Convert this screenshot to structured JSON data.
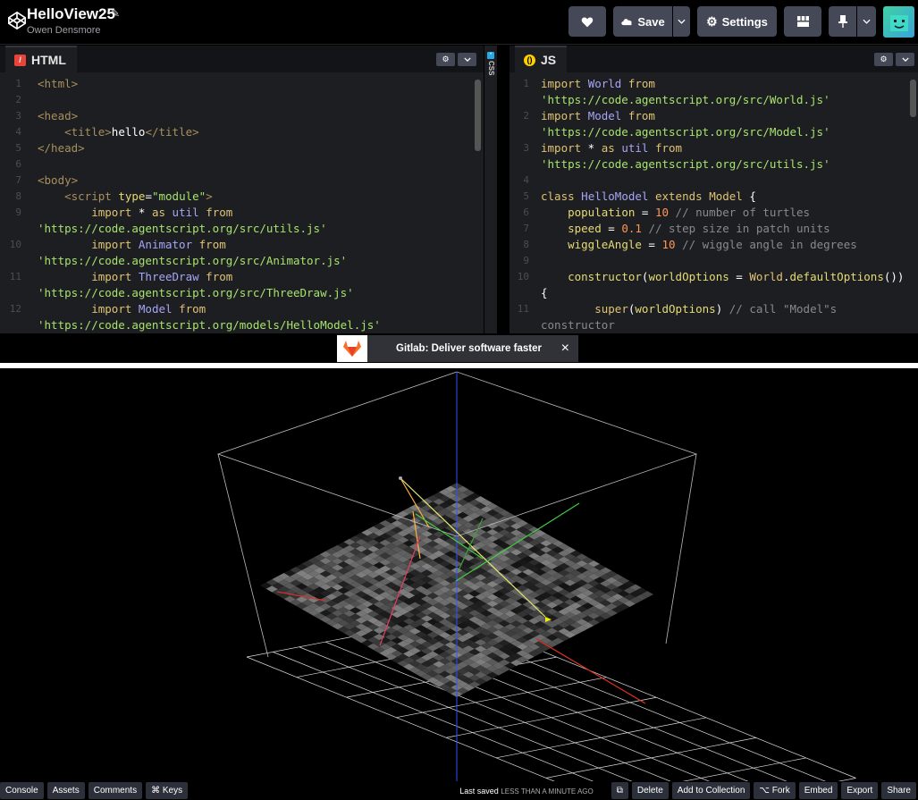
{
  "header": {
    "title": "HelloView25",
    "author": "Owen Densmore",
    "save_label": "Save",
    "settings_label": "Settings"
  },
  "html_editor": {
    "tab_label": "HTML",
    "lines": [
      {
        "n": "1",
        "t": [
          [
            "t-tag",
            "<html>"
          ]
        ]
      },
      {
        "n": "2",
        "t": []
      },
      {
        "n": "3",
        "t": [
          [
            "t-tag",
            "<head>"
          ]
        ]
      },
      {
        "n": "4",
        "t": [
          [
            "t-pl",
            "    "
          ],
          [
            "t-tag",
            "<title>"
          ],
          [
            "t-pl",
            "hello"
          ],
          [
            "t-tag",
            "</title>"
          ]
        ]
      },
      {
        "n": "5",
        "t": [
          [
            "t-tag",
            "</head>"
          ]
        ]
      },
      {
        "n": "6",
        "t": []
      },
      {
        "n": "7",
        "t": [
          [
            "t-tag",
            "<body>"
          ]
        ]
      },
      {
        "n": "8",
        "t": [
          [
            "t-pl",
            "    "
          ],
          [
            "t-tag",
            "<script "
          ],
          [
            "t-attr",
            "type"
          ],
          [
            "t-pl",
            "="
          ],
          [
            "t-str",
            "\"module\""
          ],
          [
            "t-tag",
            ">"
          ]
        ]
      },
      {
        "n": "9",
        "t": [
          [
            "t-pl",
            "        "
          ],
          [
            "t-kw",
            "import"
          ],
          [
            "t-pl",
            " * "
          ],
          [
            "t-kw",
            "as"
          ],
          [
            "t-pl",
            " "
          ],
          [
            "t-id",
            "util"
          ],
          [
            "t-pl",
            " "
          ],
          [
            "t-kw",
            "from"
          ]
        ]
      },
      {
        "n": "",
        "t": [
          [
            "t-str",
            "'https://code.agentscript.org/src/utils.js'"
          ]
        ]
      },
      {
        "n": "10",
        "t": [
          [
            "t-pl",
            "        "
          ],
          [
            "t-kw",
            "import"
          ],
          [
            "t-pl",
            " "
          ],
          [
            "t-id",
            "Animator"
          ],
          [
            "t-pl",
            " "
          ],
          [
            "t-kw",
            "from"
          ]
        ]
      },
      {
        "n": "",
        "t": [
          [
            "t-str",
            "'https://code.agentscript.org/src/Animator.js'"
          ]
        ]
      },
      {
        "n": "11",
        "t": [
          [
            "t-pl",
            "        "
          ],
          [
            "t-kw",
            "import"
          ],
          [
            "t-pl",
            " "
          ],
          [
            "t-id",
            "ThreeDraw"
          ],
          [
            "t-pl",
            " "
          ],
          [
            "t-kw",
            "from"
          ]
        ]
      },
      {
        "n": "",
        "t": [
          [
            "t-str",
            "'https://code.agentscript.org/src/ThreeDraw.js'"
          ]
        ]
      },
      {
        "n": "12",
        "t": [
          [
            "t-pl",
            "        "
          ],
          [
            "t-kw",
            "import"
          ],
          [
            "t-pl",
            " "
          ],
          [
            "t-id",
            "Model"
          ],
          [
            "t-pl",
            " "
          ],
          [
            "t-kw",
            "from"
          ]
        ]
      },
      {
        "n": "",
        "t": [
          [
            "t-str",
            "'https://code.agentscript.org/models/HelloModel.js'"
          ]
        ]
      }
    ]
  },
  "css_strip_label": "CSS",
  "js_editor": {
    "tab_label": "JS",
    "lines": [
      {
        "n": "1",
        "t": [
          [
            "t-kw",
            "import"
          ],
          [
            "t-pl",
            " "
          ],
          [
            "t-id",
            "World"
          ],
          [
            "t-pl",
            " "
          ],
          [
            "t-kw",
            "from"
          ]
        ]
      },
      {
        "n": "",
        "t": [
          [
            "t-str",
            "'https://code.agentscript.org/src/World.js'"
          ]
        ]
      },
      {
        "n": "2",
        "t": [
          [
            "t-kw",
            "import"
          ],
          [
            "t-pl",
            " "
          ],
          [
            "t-id",
            "Model"
          ],
          [
            "t-pl",
            " "
          ],
          [
            "t-kw",
            "from"
          ]
        ]
      },
      {
        "n": "",
        "t": [
          [
            "t-str",
            "'https://code.agentscript.org/src/Model.js'"
          ]
        ]
      },
      {
        "n": "3",
        "t": [
          [
            "t-kw",
            "import"
          ],
          [
            "t-pl",
            " * "
          ],
          [
            "t-kw",
            "as"
          ],
          [
            "t-pl",
            " "
          ],
          [
            "t-id",
            "util"
          ],
          [
            "t-pl",
            " "
          ],
          [
            "t-kw",
            "from"
          ]
        ]
      },
      {
        "n": "",
        "t": [
          [
            "t-str",
            "'https://code.agentscript.org/src/utils.js'"
          ]
        ]
      },
      {
        "n": "4",
        "t": []
      },
      {
        "n": "5",
        "t": [
          [
            "t-kw",
            "class"
          ],
          [
            "t-pl",
            " "
          ],
          [
            "t-id",
            "HelloModel"
          ],
          [
            "t-pl",
            " "
          ],
          [
            "t-kw",
            "extends"
          ],
          [
            "t-pl",
            " "
          ],
          [
            "t-kw",
            "Model"
          ],
          [
            "t-pl",
            " {"
          ]
        ]
      },
      {
        "n": "6",
        "t": [
          [
            "t-pl",
            "    "
          ],
          [
            "t-attr",
            "population"
          ],
          [
            "t-pl",
            " = "
          ],
          [
            "t-num",
            "10"
          ],
          [
            "t-pl",
            " "
          ],
          [
            "t-cmt",
            "// number of turtles"
          ]
        ]
      },
      {
        "n": "7",
        "t": [
          [
            "t-pl",
            "    "
          ],
          [
            "t-attr",
            "speed"
          ],
          [
            "t-pl",
            " = "
          ],
          [
            "t-num",
            "0.1"
          ],
          [
            "t-pl",
            " "
          ],
          [
            "t-cmt",
            "// step size in patch units"
          ]
        ]
      },
      {
        "n": "8",
        "t": [
          [
            "t-pl",
            "    "
          ],
          [
            "t-attr",
            "wiggleAngle"
          ],
          [
            "t-pl",
            " = "
          ],
          [
            "t-num",
            "10"
          ],
          [
            "t-pl",
            " "
          ],
          [
            "t-cmt",
            "// wiggle angle in degrees"
          ]
        ]
      },
      {
        "n": "9",
        "t": []
      },
      {
        "n": "10",
        "t": [
          [
            "t-pl",
            "    "
          ],
          [
            "t-attr",
            "constructor"
          ],
          [
            "t-pl",
            "("
          ],
          [
            "t-attr",
            "worldOptions"
          ],
          [
            "t-pl",
            " = "
          ],
          [
            "t-kw",
            "World"
          ],
          [
            "t-pl",
            "."
          ],
          [
            "t-attr",
            "defaultOptions"
          ],
          [
            "t-pl",
            "())"
          ]
        ]
      },
      {
        "n": "",
        "t": [
          [
            "t-pl",
            "{"
          ]
        ]
      },
      {
        "n": "11",
        "t": [
          [
            "t-pl",
            "        "
          ],
          [
            "t-kw",
            "super"
          ],
          [
            "t-pl",
            "("
          ],
          [
            "t-attr",
            "worldOptions"
          ],
          [
            "t-pl",
            ") "
          ],
          [
            "t-cmt",
            "// call \"Model\"s"
          ]
        ]
      },
      {
        "n": "",
        "t": [
          [
            "t-cmt",
            "constructor"
          ]
        ]
      }
    ]
  },
  "ad": {
    "text": "Gitlab: Deliver software faster",
    "close": "×"
  },
  "footer": {
    "console": "Console",
    "assets": "Assets",
    "comments": "Comments",
    "keys": "⌘ Keys",
    "last_saved_label": "Last saved",
    "last_saved_value": "LESS THAN A MINUTE AGO",
    "delete": "Delete",
    "add_to_collection": "Add to Collection",
    "fork": "⌥ Fork",
    "embed": "Embed",
    "export": "Export",
    "share": "Share"
  }
}
